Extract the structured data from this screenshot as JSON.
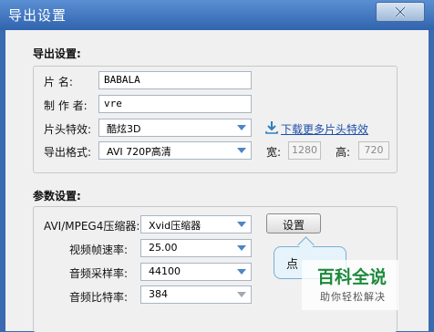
{
  "window": {
    "title": "导出设置"
  },
  "export": {
    "section_title": "导出设置:",
    "name_label": "片    名:",
    "name_value": "BABALA",
    "author_label": "制 作 者:",
    "author_value": "vre",
    "opening_label": "片头特效:",
    "opening_value": "酷炫3D",
    "download_link": "下载更多片头特效",
    "format_label": "导出格式:",
    "format_value": "AVI 720P高清",
    "width_label": "宽:",
    "width_value": "1280",
    "height_label": "高:",
    "height_value": "720"
  },
  "params": {
    "section_title": "参数设置:",
    "compressor_label": "AVI/MPEG4压缩器:",
    "compressor_value": "Xvid压缩器",
    "settings_button": "设置",
    "framerate_label": "视频帧速率:",
    "framerate_value": "25.00",
    "samplerate_label": "音频采样率:",
    "samplerate_value": "44100",
    "bitrate_label": "音频比特率:",
    "bitrate_value": "384"
  },
  "tooltip": {
    "text": "点"
  },
  "watermark": {
    "title": "百科全说",
    "subtitle": "助你轻松解决"
  },
  "colors": {
    "titlebar": "#2f63ad",
    "link": "#1d4fa8",
    "dropdown_arrow": "#4d86c4"
  }
}
